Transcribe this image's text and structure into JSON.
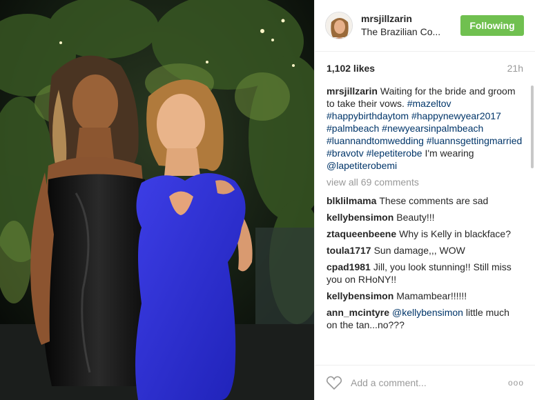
{
  "post": {
    "username": "mrsjillzarin",
    "location": "The Brazilian Co...",
    "follow_label": "Following",
    "likes": "1,102 likes",
    "time": "21h"
  },
  "caption": {
    "username": "mrsjillzarin",
    "text1": "Waiting for the bride and groom to take their vows. ",
    "tags": [
      "#mazeltov",
      "#happybirthdaytom",
      "#happynewyear2017",
      "#palmbeach",
      "#newyearsinpalmbeach",
      "#luannandtomwedding",
      "#luannsgettingmarried",
      "#bravotv",
      "#lepetiterobe"
    ],
    "text2": "I'm wearing",
    "mention": "@lapetiterobemi"
  },
  "view_all": "view all 69 comments",
  "comments": [
    {
      "user": "blklilmama",
      "text": "These comments are sad"
    },
    {
      "user": "kellybensimon",
      "text": "Beauty!!!"
    },
    {
      "user": "ztaqueenbeene",
      "text": "Why is Kelly in blackface?"
    },
    {
      "user": "toula1717",
      "text": "Sun damage,,, WOW"
    },
    {
      "user": "cpad1981",
      "text": "Jill, you look stunning!! Still miss you on RHoNY!!"
    },
    {
      "user": "kellybensimon",
      "text": "Mamambear!!!!!!"
    },
    {
      "user": "ann_mcintyre",
      "mention": "@kellybensimon",
      "text": "little much on the tan...no???"
    }
  ],
  "footer": {
    "placeholder": "Add a comment...",
    "more": "ooo"
  },
  "icons": {
    "heart": "heart-icon",
    "more": "more-options-icon"
  },
  "colors": {
    "follow_button": "#70c050",
    "link": "#003569",
    "muted": "#999999"
  }
}
